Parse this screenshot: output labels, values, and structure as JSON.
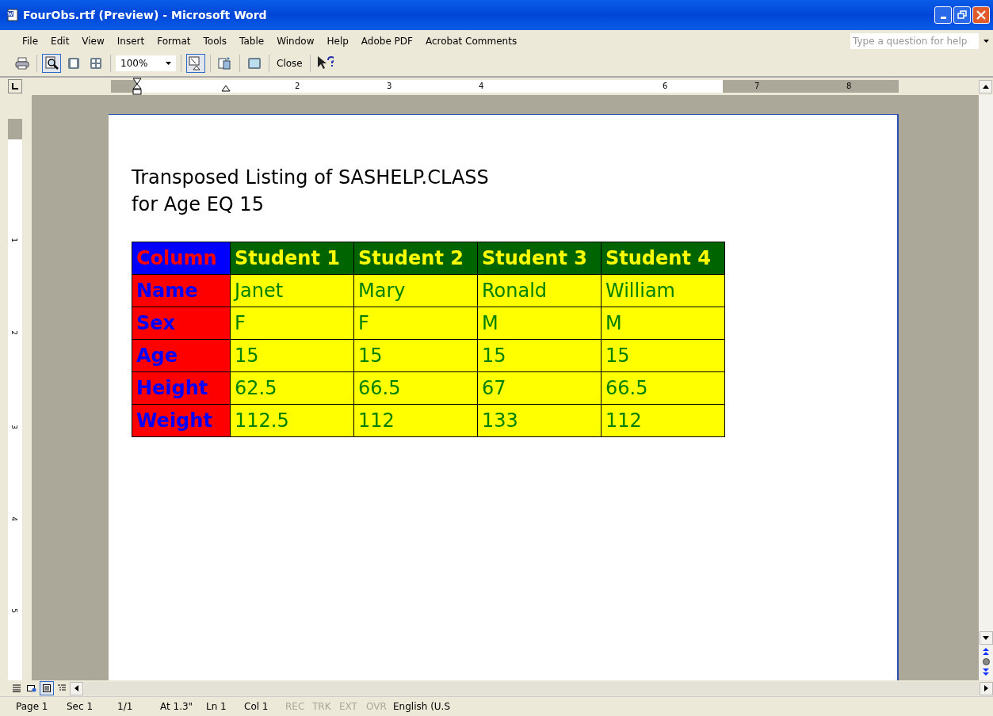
{
  "window": {
    "title": "FourObs.rtf (Preview) - Microsoft Word"
  },
  "menu": [
    "File",
    "Edit",
    "View",
    "Insert",
    "Format",
    "Tools",
    "Table",
    "Window",
    "Help",
    "Adobe PDF",
    "Acrobat Comments"
  ],
  "help_box": {
    "placeholder": "Type a question for help"
  },
  "toolbar": {
    "tools": [
      {
        "kind": "print",
        "selected": false
      },
      {
        "kind": "preview",
        "selected": true
      },
      {
        "kind": "one-page",
        "selected": false
      },
      {
        "kind": "multi-page",
        "selected": false
      },
      {
        "kind": "zoom",
        "value": "100%"
      },
      {
        "kind": "magnifier",
        "selected": true
      },
      {
        "kind": "shrink",
        "selected": false
      },
      {
        "kind": "fullscreen",
        "selected": false
      },
      {
        "kind": "close",
        "label": "Close"
      },
      {
        "kind": "help",
        "selected": false
      }
    ]
  },
  "ruler": {
    "labels": [
      "2",
      "3",
      "4",
      "6",
      "7",
      "8"
    ]
  },
  "vertical_ruler": {
    "labels": [
      "1",
      "2",
      "3",
      "4",
      "5"
    ]
  },
  "document": {
    "title_lines": [
      "Transposed Listing of SASHELP.CLASS",
      "for Age EQ 15"
    ],
    "table": {
      "columns": [
        "Column",
        "Student 1",
        "Student 2",
        "Student 3",
        "Student 4"
      ],
      "rows": [
        [
          "Name",
          "Janet",
          "Mary",
          "Ronald",
          "William"
        ],
        [
          "Sex",
          "F",
          "F",
          "M",
          "M"
        ],
        [
          "Age",
          "15",
          "15",
          "15",
          "15"
        ],
        [
          "Height",
          "62.5",
          "66.5",
          "67",
          "66.5"
        ],
        [
          "Weight",
          "112.5",
          "112",
          "133",
          "112"
        ]
      ]
    }
  },
  "view_buttons": [
    {
      "kind": "normal",
      "selected": false
    },
    {
      "kind": "web",
      "selected": false
    },
    {
      "kind": "print",
      "selected": true
    },
    {
      "kind": "outline",
      "selected": false
    }
  ],
  "status_bar": [
    {
      "text": "Page 1",
      "disabled": false
    },
    {
      "text": "Sec 1",
      "disabled": false
    },
    {
      "text": "1/1",
      "disabled": false
    },
    {
      "text": "At 1.3\"",
      "disabled": false
    },
    {
      "text": "Ln 1",
      "disabled": false
    },
    {
      "text": "Col 1",
      "disabled": false
    },
    {
      "text": "REC",
      "disabled": true
    },
    {
      "text": "TRK",
      "disabled": true
    },
    {
      "text": "EXT",
      "disabled": true
    },
    {
      "text": "OVR",
      "disabled": true
    },
    {
      "text": "English (U.S",
      "disabled": false
    }
  ]
}
